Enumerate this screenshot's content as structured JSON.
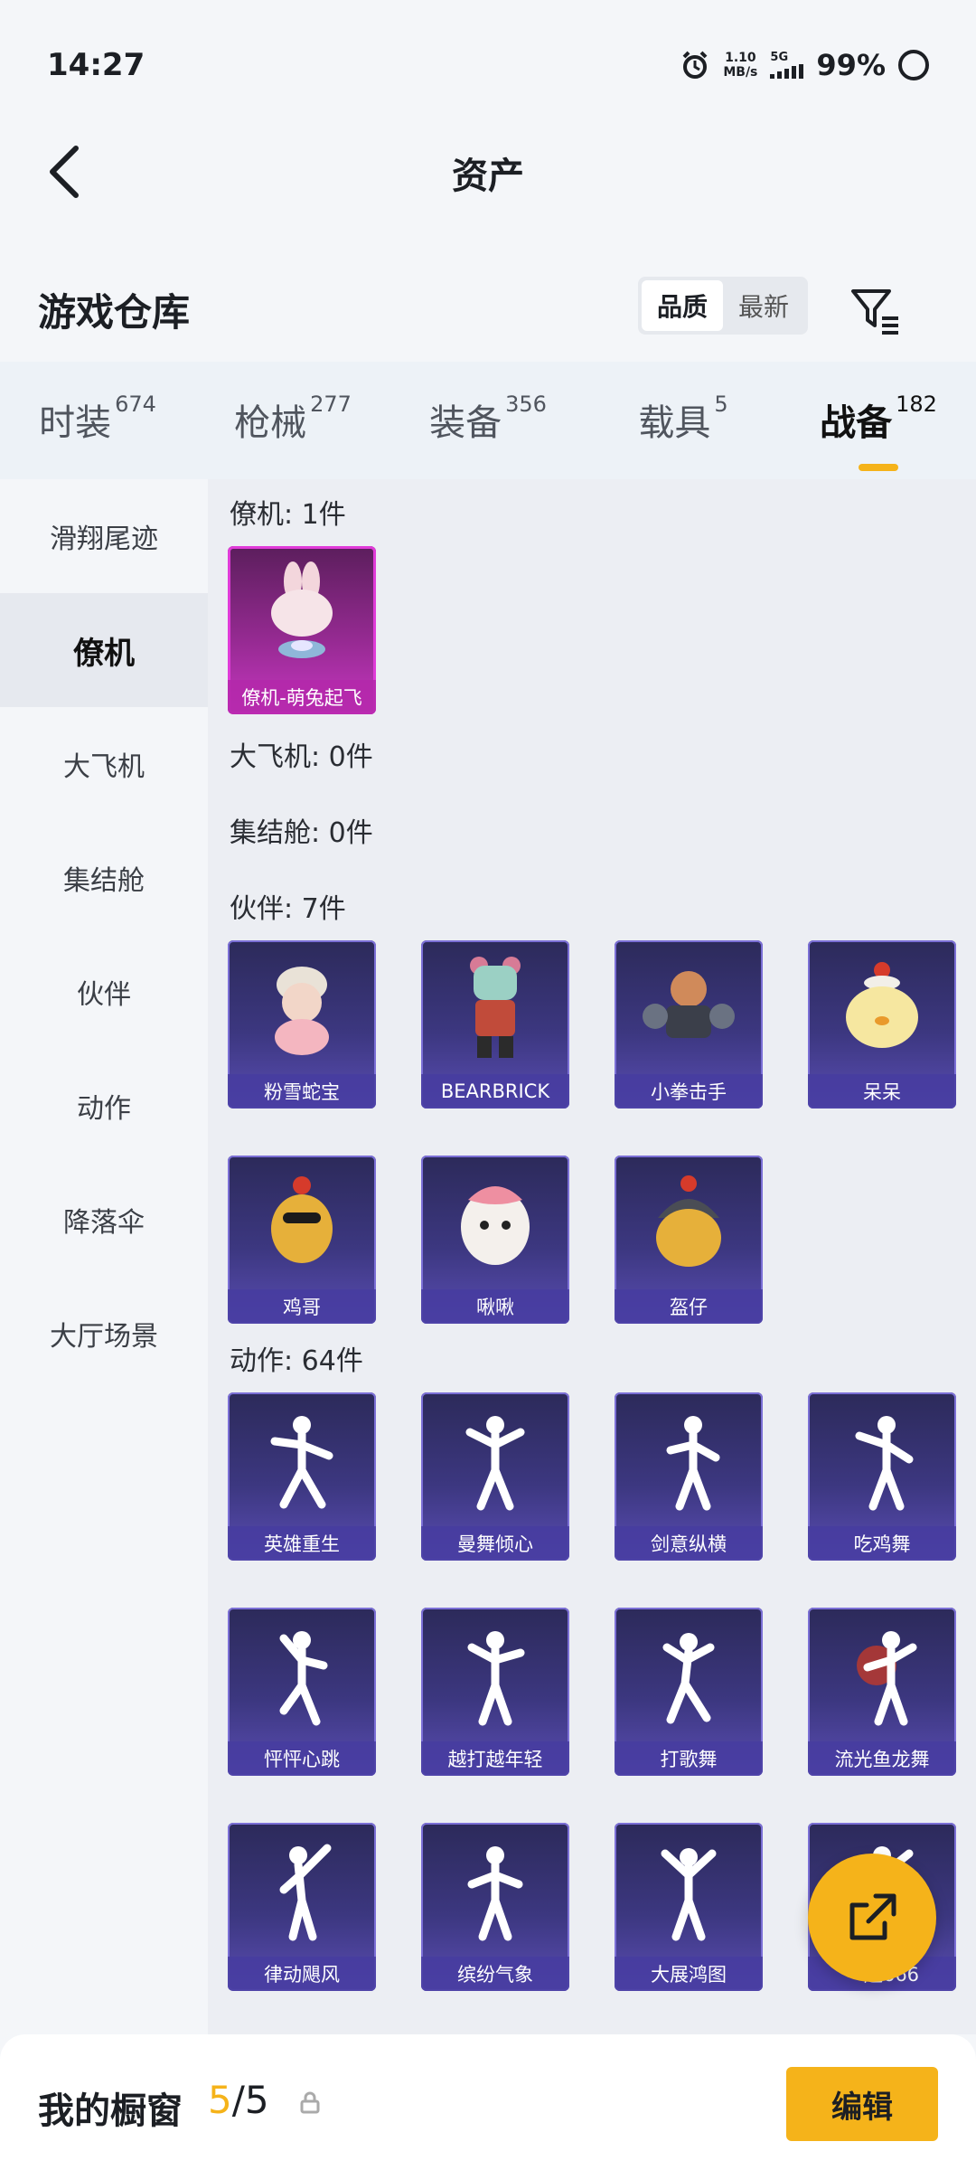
{
  "status": {
    "time": "14:27",
    "net_speed_value": "1.10",
    "net_speed_unit": "MB/s",
    "network": "5G",
    "battery": "99%"
  },
  "header": {
    "title": "资产"
  },
  "section": {
    "title": "游戏仓库",
    "sort_options": [
      "品质",
      "最新"
    ],
    "sort_selected": "品质"
  },
  "category_tabs": [
    {
      "label": "时装",
      "count": "674"
    },
    {
      "label": "枪械",
      "count": "277"
    },
    {
      "label": "装备",
      "count": "356"
    },
    {
      "label": "载具",
      "count": "5"
    },
    {
      "label": "战备",
      "count": "182"
    }
  ],
  "active_tab": "战备",
  "sidebar": {
    "items": [
      "滑翔尾迹",
      "僚机",
      "大飞机",
      "集结舱",
      "伙伴",
      "动作",
      "降落伞",
      "大厅场景"
    ],
    "active": "僚机"
  },
  "groups": {
    "wingman": {
      "title": "僚机: 1件",
      "items": [
        "僚机-萌兔起飞"
      ]
    },
    "bigplane": {
      "title": "大飞机: 0件"
    },
    "capsule": {
      "title": "集结舱: 0件"
    },
    "companion": {
      "title": "伙伴: 7件",
      "items": [
        "粉雪蛇宝",
        "BEARBRICK",
        "小拳击手",
        "呆呆",
        "鸡哥",
        "啾啾",
        "盔仔"
      ]
    },
    "emote": {
      "title": "动作: 64件",
      "items": [
        "英雄重生",
        "曼舞倾心",
        "剑意纵横",
        "吃鸡舞",
        "怦怦心跳",
        "越打越年轻",
        "打歌舞",
        "流光鱼龙舞",
        "律动飓风",
        "缤纷气象",
        "大展鸿图",
        "一起666"
      ]
    }
  },
  "bottom": {
    "title": "我的橱窗",
    "count_current": "5",
    "count_sep": "/",
    "count_total": "5",
    "edit_label": "编辑"
  },
  "colors": {
    "accent": "#f5b31a",
    "card_purple": "#3c3780",
    "card_pink": "#c637c0"
  }
}
